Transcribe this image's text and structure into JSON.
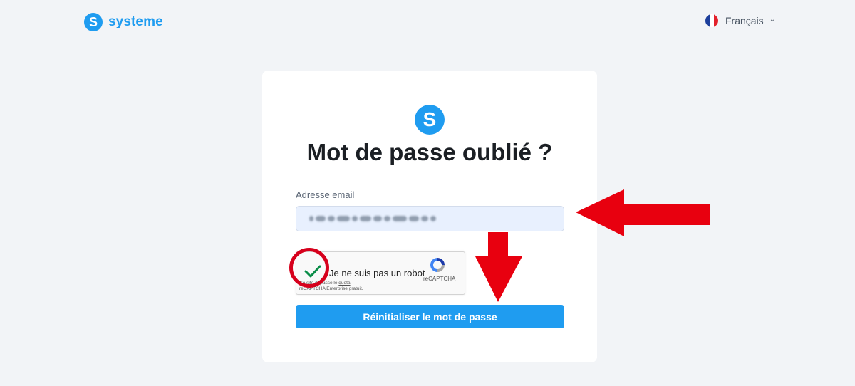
{
  "header": {
    "brand_initial": "S",
    "brand_name": "systeme",
    "language": "Français"
  },
  "card": {
    "logo_initial": "S",
    "title": "Mot de passe oublié ?",
    "email_label": "Adresse email",
    "email_value_hidden": true,
    "captcha": {
      "label": "Je ne suis pas un robot",
      "note_line1": "Ce site dépasse le",
      "note_link1": "quota",
      "note_line2": "reCAPTCHA Enterprise gratuit.",
      "brand": "reCAPTCHA",
      "checked": true
    },
    "submit_label": "Réinitialiser le mot de passe"
  },
  "colors": {
    "brand_blue": "#1f9cf0",
    "annotation_red": "#e8000f",
    "check_green": "#0a8d48",
    "background": "#f2f4f7"
  }
}
